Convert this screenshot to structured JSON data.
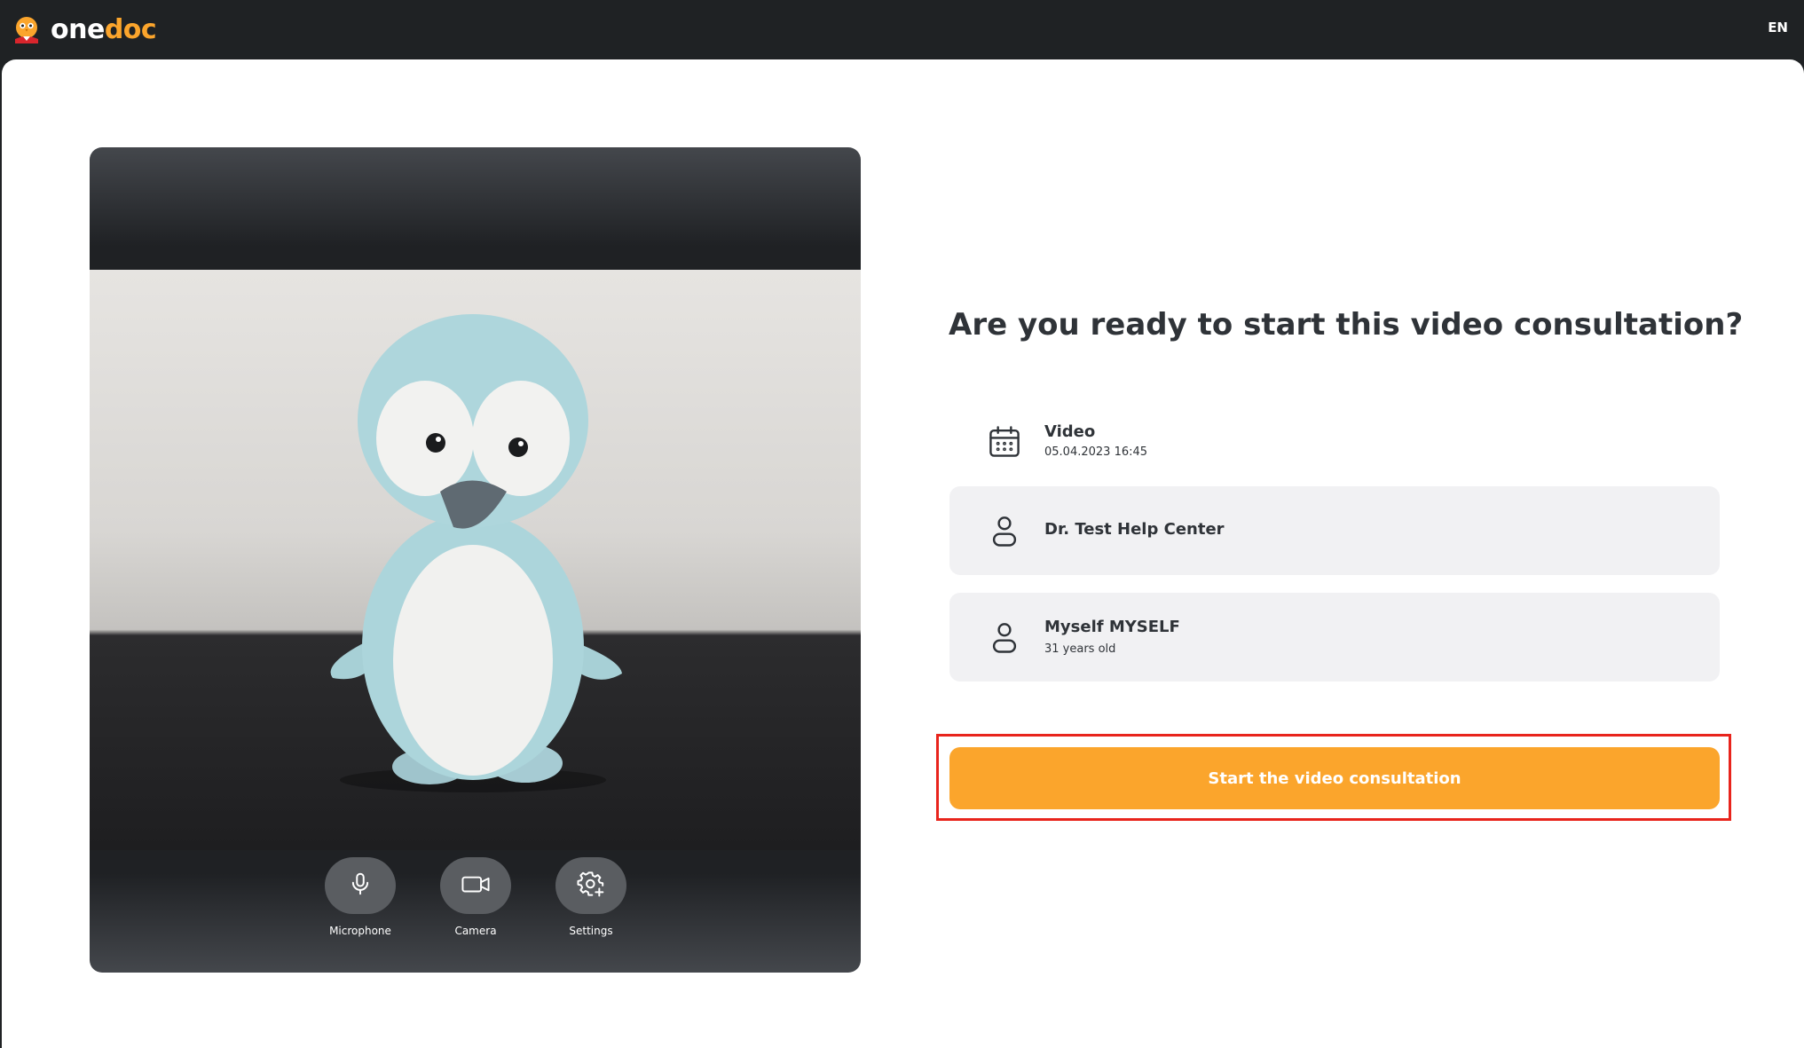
{
  "brand": {
    "name_part1": "one",
    "name_part2": "doc",
    "logo_icon": "owl-doctor-icon",
    "accent": "#fba52c"
  },
  "header": {
    "language": "EN"
  },
  "video": {
    "controls": [
      {
        "label": "Microphone",
        "icon": "microphone-icon"
      },
      {
        "label": "Camera",
        "icon": "camera-icon"
      },
      {
        "label": "Settings",
        "icon": "settings-plus-icon"
      }
    ]
  },
  "consultation": {
    "heading": "Are you ready to start this video consultation?",
    "appointment": {
      "type": "Video",
      "datetime": "05.04.2023 16:45",
      "icon": "calendar-icon"
    },
    "doctor": {
      "name": "Dr. Test Help Center",
      "icon": "person-icon"
    },
    "patient": {
      "name": "Myself MYSELF",
      "age": "31 years old",
      "icon": "person-icon"
    },
    "start_button": "Start the video consultation",
    "highlight_color": "#e8241c"
  }
}
